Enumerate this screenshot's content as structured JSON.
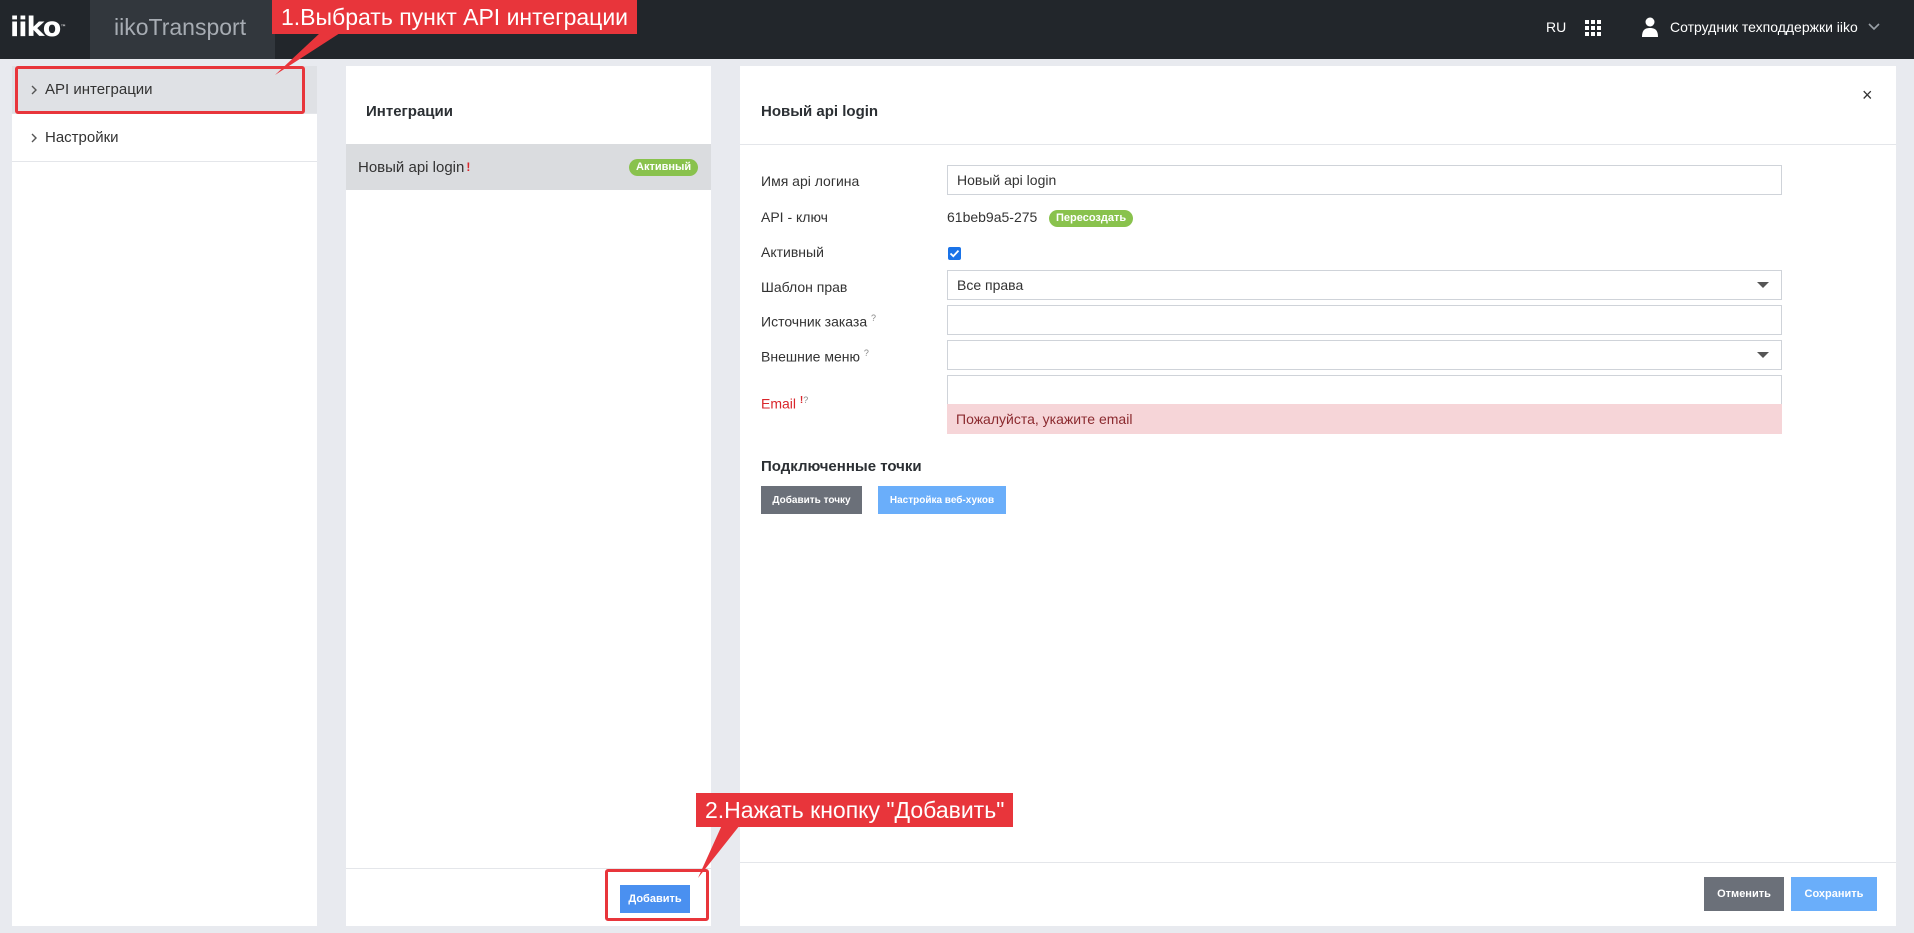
{
  "topbar": {
    "logo": "iiko",
    "app_title": "iikoTransport",
    "language": "RU",
    "user_name": "Сотрудник техподдержки iiko"
  },
  "sidebar": {
    "items": [
      {
        "label": "API интеграции",
        "active": true
      },
      {
        "label": "Настройки",
        "active": false
      }
    ]
  },
  "list_panel": {
    "title": "Интеграции",
    "rows": [
      {
        "name": "Новый api login",
        "mark": "!",
        "status": "Активный"
      }
    ],
    "add_button": "Добавить"
  },
  "detail": {
    "title": "Новый api login",
    "close": "×",
    "fields": {
      "login_label": "Имя api логина",
      "login_value": "Новый api login",
      "apikey_label": "API - ключ",
      "apikey_value": "61beb9a5-275",
      "recreate_label": "Пересоздать",
      "active_label": "Активный",
      "active_checked": true,
      "template_label": "Шаблон прав",
      "template_value": "Все права",
      "source_label": "Источник заказа",
      "source_value": "",
      "menu_label": "Внешние меню",
      "menu_value": "",
      "email_label": "Email",
      "email_value": "",
      "email_error": "Пожалуйста, укажите email",
      "help_mark": "?",
      "required_mark": "!"
    },
    "points_title": "Подключенные точки",
    "add_point_button": "Добавить точку",
    "webhooks_button": "Настройка веб-хуков",
    "cancel_button": "Отменить",
    "save_button": "Сохранить"
  },
  "annotations": {
    "step1": "1.Выбрать пункт API интеграции",
    "step2": "2.Нажать кнопку \"Добавить\""
  },
  "colors": {
    "topbar": "#22262b",
    "accent_blue": "#4a90f0",
    "status_green": "#89c24d",
    "annotation_red": "#e8353b",
    "error_bg": "#f6d5d8"
  }
}
